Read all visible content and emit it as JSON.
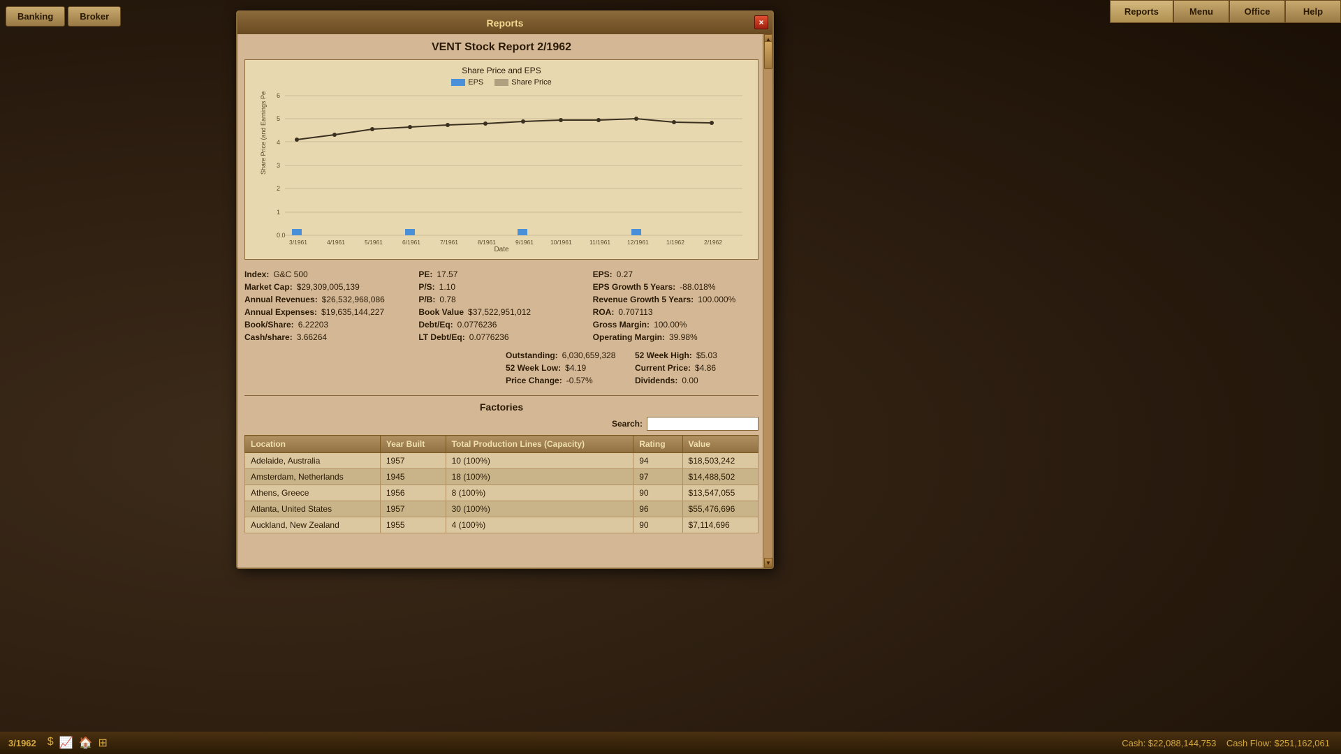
{
  "app": {
    "title": "Reports",
    "date": "3/1962"
  },
  "topNavLeft": {
    "banking_label": "Banking",
    "broker_label": "Broker"
  },
  "topNavRight": {
    "reports_label": "Reports",
    "menu_label": "Menu",
    "office_label": "Office",
    "help_label": "Help"
  },
  "window": {
    "title": "Reports",
    "report_title": "VENT Stock Report 2/1962",
    "close_label": "×"
  },
  "chart": {
    "title": "Share Price and EPS",
    "legend_eps": "EPS",
    "legend_price": "Share Price",
    "y_axis_label": "Share Price (and Earnings Per Share)",
    "x_axis_label": "Date",
    "x_labels": [
      "3/1961",
      "4/1961",
      "5/1961",
      "6/1961",
      "7/1961",
      "8/1961",
      "9/1961",
      "10/1961",
      "11/1961",
      "12/1961",
      "1/1962",
      "2/1962"
    ],
    "y_labels": [
      "0.0",
      "1",
      "2",
      "3",
      "4",
      "5",
      "6"
    ],
    "price_line": [
      4.1,
      4.3,
      4.55,
      4.65,
      4.75,
      4.8,
      4.9,
      4.95,
      4.95,
      5.0,
      4.88,
      4.86
    ],
    "eps_bars": [
      0.28,
      0,
      0,
      0.27,
      0,
      0,
      0.27,
      0,
      0,
      0.27,
      0,
      0
    ]
  },
  "stats": {
    "index_label": "Index:",
    "index_value": "G&C 500",
    "market_cap_label": "Market Cap:",
    "market_cap_value": "$29,309,005,139",
    "annual_rev_label": "Annual Revenues:",
    "annual_rev_value": "$26,532,968,086",
    "annual_exp_label": "Annual Expenses:",
    "annual_exp_value": "$19,635,144,227",
    "book_share_label": "Book/Share:",
    "book_share_value": "6.22203",
    "cash_share_label": "Cash/share:",
    "cash_share_value": "3.66264",
    "pe_label": "PE:",
    "pe_value": "17.57",
    "ps_label": "P/S:",
    "ps_value": "1.10",
    "pb_label": "P/B:",
    "pb_value": "0.78",
    "book_value_label": "Book Value",
    "book_value_value": "$37,522,951,012",
    "debt_eq_label": "Debt/Eq:",
    "debt_eq_value": "0.0776236",
    "lt_debt_eq_label": "LT Debt/Eq:",
    "lt_debt_eq_value": "0.0776236",
    "eps_label": "EPS:",
    "eps_value": "0.27",
    "eps_growth_label": "EPS Growth 5 Years:",
    "eps_growth_value": "-88.018%",
    "rev_growth_label": "Revenue Growth 5 Years:",
    "rev_growth_value": "100.000%",
    "roa_label": "ROA:",
    "roa_value": "0.707113",
    "gross_margin_label": "Gross Margin:",
    "gross_margin_value": "100.00%",
    "op_margin_label": "Operating Margin:",
    "op_margin_value": "39.98%",
    "outstanding_label": "Outstanding:",
    "outstanding_value": "6,030,659,328",
    "week52_high_label": "52 Week High:",
    "week52_high_value": "$5.03",
    "week52_low_label": "52 Week Low:",
    "week52_low_value": "$4.19",
    "current_price_label": "Current Price:",
    "current_price_value": "$4.86",
    "price_change_label": "Price Change:",
    "price_change_value": "-0.57%",
    "dividends_label": "Dividends:",
    "dividends_value": "0.00"
  },
  "factories": {
    "section_title": "Factories",
    "search_label": "Search:",
    "search_placeholder": "",
    "columns": {
      "location": "Location",
      "year_built": "Year Built",
      "production_lines": "Total Production Lines (Capacity)",
      "rating": "Rating",
      "value": "Value"
    },
    "rows": [
      {
        "location": "Adelaide, Australia",
        "year_built": "1957",
        "lines": "10  (100%)",
        "rating": "94",
        "value": "$18,503,242"
      },
      {
        "location": "Amsterdam, Netherlands",
        "year_built": "1945",
        "lines": "18  (100%)",
        "rating": "97",
        "value": "$14,488,502"
      },
      {
        "location": "Athens, Greece",
        "year_built": "1956",
        "lines": "8  (100%)",
        "rating": "90",
        "value": "$13,547,055"
      },
      {
        "location": "Atlanta, United States",
        "year_built": "1957",
        "lines": "30  (100%)",
        "rating": "96",
        "value": "$55,476,696"
      },
      {
        "location": "Auckland, New Zealand",
        "year_built": "1955",
        "lines": "4  (100%)",
        "rating": "90",
        "value": "$7,114,696"
      }
    ]
  },
  "bottomBar": {
    "date": "3/1962",
    "cash_label": "Cash: $22,088,144,753",
    "cashflow_label": "Cash Flow: $251,162,061"
  }
}
